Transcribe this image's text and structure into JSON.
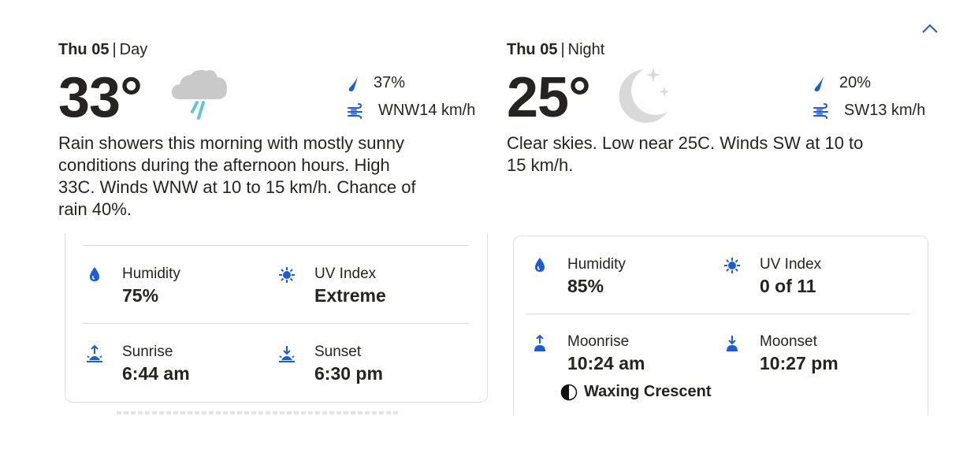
{
  "colors": {
    "accent": "#1a5ddc",
    "text": "#252422",
    "rain": "#5ec5e6",
    "cloud": "#c9c9c9"
  },
  "day": {
    "date": "Thu 05",
    "period": "Day",
    "temperature": "33°",
    "condition_icon": "rain-shower-cloud-icon",
    "precip": "37%",
    "wind": "WNW14 km/h",
    "narrative": "Rain showers this morning with mostly sunny conditions during the afternoon hours. High 33C. Winds WNW at 10 to 15 km/h. Chance of rain 40%.",
    "details": {
      "humidity_label": "Humidity",
      "humidity_value": "75%",
      "uv_label": "UV Index",
      "uv_value": "Extreme",
      "sunrise_label": "Sunrise",
      "sunrise_value": "6:44 am",
      "sunset_label": "Sunset",
      "sunset_value": "6:30 pm"
    }
  },
  "night": {
    "date": "Thu 05",
    "period": "Night",
    "temperature": "25°",
    "condition_icon": "clear-night-moon-icon",
    "precip": "20%",
    "wind": "SW13 km/h",
    "narrative": "Clear skies. Low near 25C. Winds SW at 10 to 15 km/h.",
    "details": {
      "humidity_label": "Humidity",
      "humidity_value": "85%",
      "uv_label": "UV Index",
      "uv_value": "0 of 11",
      "moonrise_label": "Moonrise",
      "moonrise_value": "10:24 am",
      "moonset_label": "Moonset",
      "moonset_value": "10:27 pm",
      "moon_phase": "Waxing Crescent"
    }
  }
}
